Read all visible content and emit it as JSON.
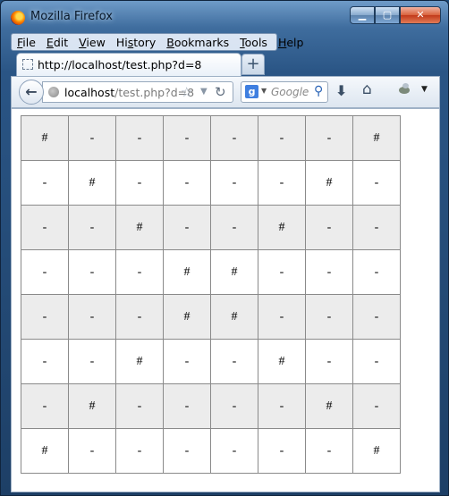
{
  "window": {
    "title": "Mozilla Firefox",
    "buttons": {
      "minimize": "▁",
      "maximize": "▢",
      "close": "✕"
    }
  },
  "menubar": {
    "items": [
      {
        "key": "F",
        "rest": "ile"
      },
      {
        "key": "E",
        "rest": "dit"
      },
      {
        "key": "V",
        "rest": "iew"
      },
      {
        "key": "",
        "rest": "Hi",
        "key2": "s",
        "rest2": "tory"
      },
      {
        "key": "B",
        "rest": "ookmarks"
      },
      {
        "key": "T",
        "rest": "ools"
      },
      {
        "key": "H",
        "rest": "elp"
      }
    ]
  },
  "tabs": [
    {
      "label": "http://localhost/test.php?d=8"
    }
  ],
  "new_tab_label": "+",
  "navbar": {
    "url_host": "localhost",
    "url_path": "/test.php?d=8",
    "search_placeholder": "Google",
    "search_engine_icon": "g-icon"
  },
  "grid": {
    "rows": [
      [
        "#",
        "-",
        "-",
        "-",
        "-",
        "-",
        "-",
        "#"
      ],
      [
        "-",
        "#",
        "-",
        "-",
        "-",
        "-",
        "#",
        "-"
      ],
      [
        "-",
        "-",
        "#",
        "-",
        "-",
        "#",
        "-",
        "-"
      ],
      [
        "-",
        "-",
        "-",
        "#",
        "#",
        "-",
        "-",
        "-"
      ],
      [
        "-",
        "-",
        "-",
        "#",
        "#",
        "-",
        "-",
        "-"
      ],
      [
        "-",
        "-",
        "#",
        "-",
        "-",
        "#",
        "-",
        "-"
      ],
      [
        "-",
        "#",
        "-",
        "-",
        "-",
        "-",
        "#",
        "-"
      ],
      [
        "#",
        "-",
        "-",
        "-",
        "-",
        "-",
        "-",
        "#"
      ]
    ],
    "shaded_row_color": "#ececec"
  }
}
